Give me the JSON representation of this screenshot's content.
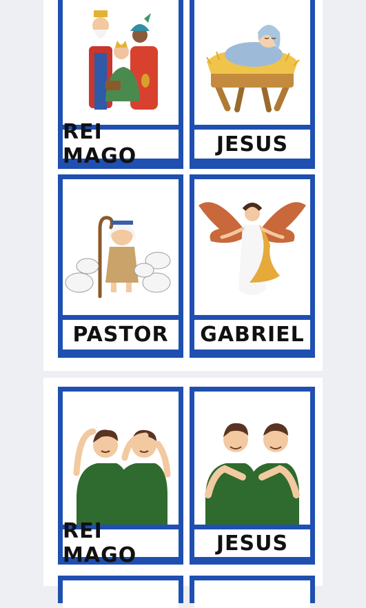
{
  "sheets": [
    {
      "cards": [
        {
          "label": "REI MAGO",
          "icon": "three-wise-men-illustration"
        },
        {
          "label": "JESUS",
          "icon": "baby-in-manger-illustration"
        },
        {
          "label": "PASTOR",
          "icon": "shepherd-with-sheep-illustration"
        },
        {
          "label": "GABRIEL",
          "icon": "angel-illustration"
        }
      ]
    },
    {
      "cards": [
        {
          "label": "REI MAGO",
          "icon": "sign-language-rei-mago-illustration"
        },
        {
          "label": "JESUS",
          "icon": "sign-language-jesus-illustration"
        }
      ]
    }
  ],
  "colors": {
    "card_border": "#1f4fb0",
    "sheet": "#ffffff",
    "background": "#eeeff2"
  }
}
